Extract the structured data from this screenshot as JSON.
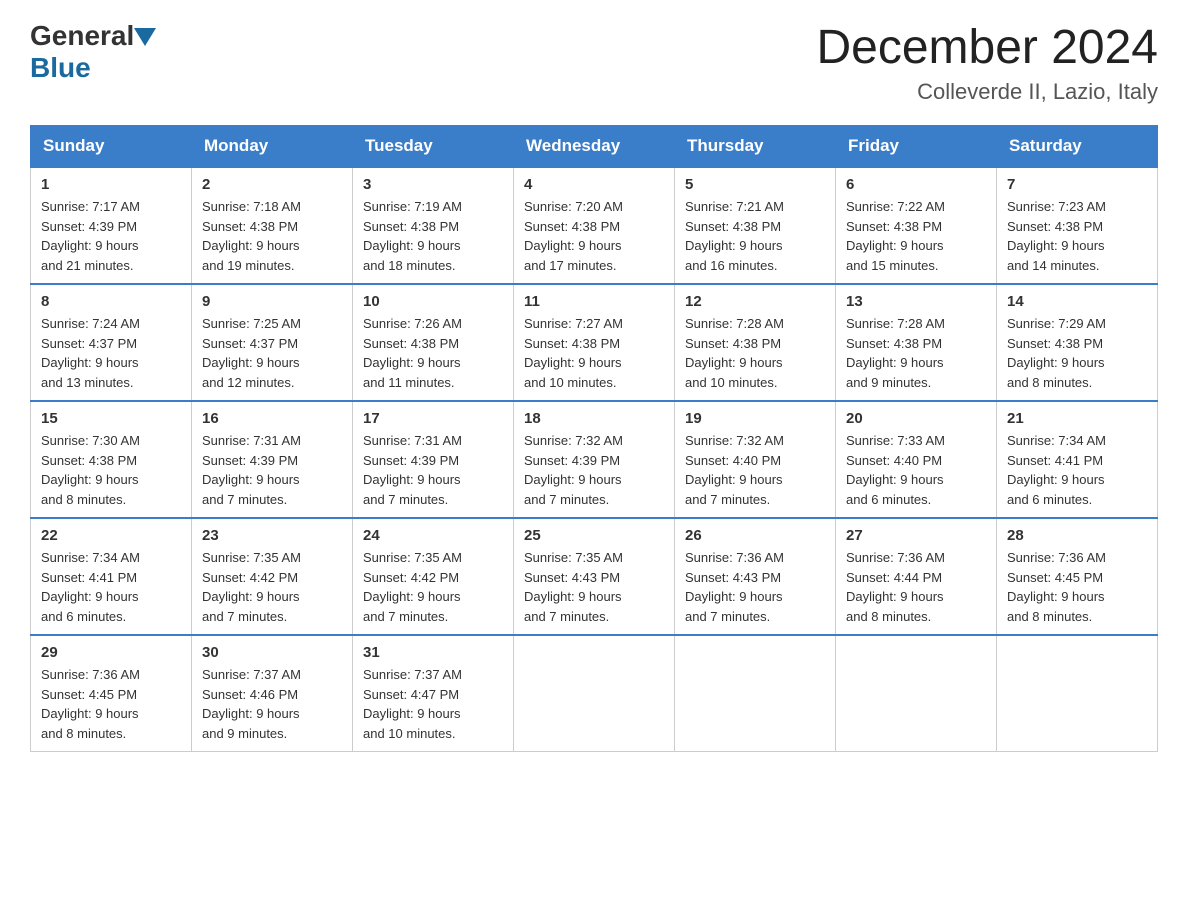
{
  "header": {
    "logo_general": "General",
    "logo_blue": "Blue",
    "month_title": "December 2024",
    "subtitle": "Colleverde II, Lazio, Italy"
  },
  "weekdays": [
    "Sunday",
    "Monday",
    "Tuesday",
    "Wednesday",
    "Thursday",
    "Friday",
    "Saturday"
  ],
  "weeks": [
    [
      {
        "day": "1",
        "sunrise": "7:17 AM",
        "sunset": "4:39 PM",
        "daylight": "9 hours and 21 minutes."
      },
      {
        "day": "2",
        "sunrise": "7:18 AM",
        "sunset": "4:38 PM",
        "daylight": "9 hours and 19 minutes."
      },
      {
        "day": "3",
        "sunrise": "7:19 AM",
        "sunset": "4:38 PM",
        "daylight": "9 hours and 18 minutes."
      },
      {
        "day": "4",
        "sunrise": "7:20 AM",
        "sunset": "4:38 PM",
        "daylight": "9 hours and 17 minutes."
      },
      {
        "day": "5",
        "sunrise": "7:21 AM",
        "sunset": "4:38 PM",
        "daylight": "9 hours and 16 minutes."
      },
      {
        "day": "6",
        "sunrise": "7:22 AM",
        "sunset": "4:38 PM",
        "daylight": "9 hours and 15 minutes."
      },
      {
        "day": "7",
        "sunrise": "7:23 AM",
        "sunset": "4:38 PM",
        "daylight": "9 hours and 14 minutes."
      }
    ],
    [
      {
        "day": "8",
        "sunrise": "7:24 AM",
        "sunset": "4:37 PM",
        "daylight": "9 hours and 13 minutes."
      },
      {
        "day": "9",
        "sunrise": "7:25 AM",
        "sunset": "4:37 PM",
        "daylight": "9 hours and 12 minutes."
      },
      {
        "day": "10",
        "sunrise": "7:26 AM",
        "sunset": "4:38 PM",
        "daylight": "9 hours and 11 minutes."
      },
      {
        "day": "11",
        "sunrise": "7:27 AM",
        "sunset": "4:38 PM",
        "daylight": "9 hours and 10 minutes."
      },
      {
        "day": "12",
        "sunrise": "7:28 AM",
        "sunset": "4:38 PM",
        "daylight": "9 hours and 10 minutes."
      },
      {
        "day": "13",
        "sunrise": "7:28 AM",
        "sunset": "4:38 PM",
        "daylight": "9 hours and 9 minutes."
      },
      {
        "day": "14",
        "sunrise": "7:29 AM",
        "sunset": "4:38 PM",
        "daylight": "9 hours and 8 minutes."
      }
    ],
    [
      {
        "day": "15",
        "sunrise": "7:30 AM",
        "sunset": "4:38 PM",
        "daylight": "9 hours and 8 minutes."
      },
      {
        "day": "16",
        "sunrise": "7:31 AM",
        "sunset": "4:39 PM",
        "daylight": "9 hours and 7 minutes."
      },
      {
        "day": "17",
        "sunrise": "7:31 AM",
        "sunset": "4:39 PM",
        "daylight": "9 hours and 7 minutes."
      },
      {
        "day": "18",
        "sunrise": "7:32 AM",
        "sunset": "4:39 PM",
        "daylight": "9 hours and 7 minutes."
      },
      {
        "day": "19",
        "sunrise": "7:32 AM",
        "sunset": "4:40 PM",
        "daylight": "9 hours and 7 minutes."
      },
      {
        "day": "20",
        "sunrise": "7:33 AM",
        "sunset": "4:40 PM",
        "daylight": "9 hours and 6 minutes."
      },
      {
        "day": "21",
        "sunrise": "7:34 AM",
        "sunset": "4:41 PM",
        "daylight": "9 hours and 6 minutes."
      }
    ],
    [
      {
        "day": "22",
        "sunrise": "7:34 AM",
        "sunset": "4:41 PM",
        "daylight": "9 hours and 6 minutes."
      },
      {
        "day": "23",
        "sunrise": "7:35 AM",
        "sunset": "4:42 PM",
        "daylight": "9 hours and 7 minutes."
      },
      {
        "day": "24",
        "sunrise": "7:35 AM",
        "sunset": "4:42 PM",
        "daylight": "9 hours and 7 minutes."
      },
      {
        "day": "25",
        "sunrise": "7:35 AM",
        "sunset": "4:43 PM",
        "daylight": "9 hours and 7 minutes."
      },
      {
        "day": "26",
        "sunrise": "7:36 AM",
        "sunset": "4:43 PM",
        "daylight": "9 hours and 7 minutes."
      },
      {
        "day": "27",
        "sunrise": "7:36 AM",
        "sunset": "4:44 PM",
        "daylight": "9 hours and 8 minutes."
      },
      {
        "day": "28",
        "sunrise": "7:36 AM",
        "sunset": "4:45 PM",
        "daylight": "9 hours and 8 minutes."
      }
    ],
    [
      {
        "day": "29",
        "sunrise": "7:36 AM",
        "sunset": "4:45 PM",
        "daylight": "9 hours and 8 minutes."
      },
      {
        "day": "30",
        "sunrise": "7:37 AM",
        "sunset": "4:46 PM",
        "daylight": "9 hours and 9 minutes."
      },
      {
        "day": "31",
        "sunrise": "7:37 AM",
        "sunset": "4:47 PM",
        "daylight": "9 hours and 10 minutes."
      },
      null,
      null,
      null,
      null
    ]
  ],
  "labels": {
    "sunrise": "Sunrise:",
    "sunset": "Sunset:",
    "daylight": "Daylight:"
  }
}
